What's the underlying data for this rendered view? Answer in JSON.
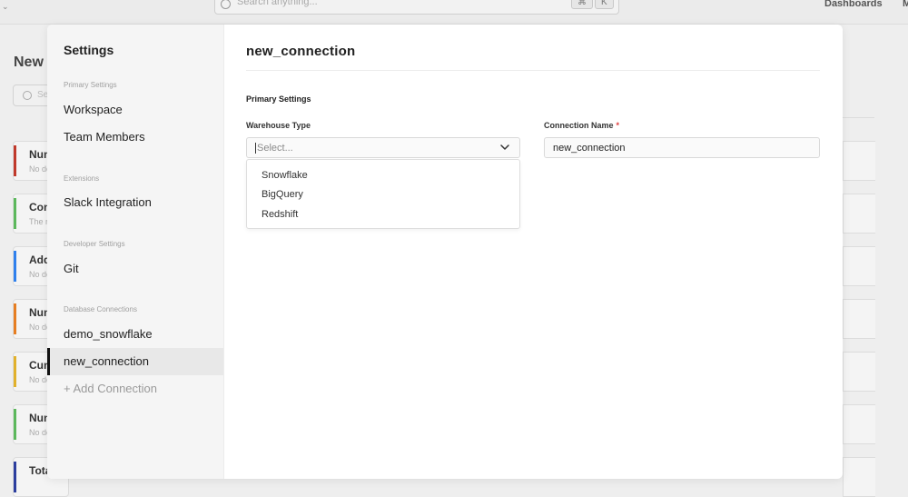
{
  "background": {
    "search_placeholder": "Search anything...",
    "shortcut_keys": [
      "⌘",
      "K"
    ],
    "nav_dashboards": "Dashboards",
    "nav_partial": "M",
    "page_title": "New c",
    "search_partial": "Se",
    "cards": [
      {
        "title": "Num",
        "subtitle": "No de",
        "accent": "#c0392b"
      },
      {
        "title": "Con",
        "subtitle": "The n",
        "accent": "#5cb85c"
      },
      {
        "title": "Add",
        "subtitle": "No de",
        "accent": "#2f80ed"
      },
      {
        "title": "Num",
        "subtitle": "No de",
        "accent": "#e67e22"
      },
      {
        "title": "Cun",
        "subtitle": "No de",
        "accent": "#e1b12c"
      },
      {
        "title": "Nun",
        "subtitle": "No de",
        "accent": "#5cb85c"
      },
      {
        "title": "Tota",
        "subtitle": "",
        "accent": "#2c3e9e"
      }
    ]
  },
  "settings": {
    "title": "Settings",
    "sections": {
      "primary": "Primary Settings",
      "extensions": "Extensions",
      "developer": "Developer Settings",
      "database": "Database Connections"
    },
    "items": {
      "workspace": "Workspace",
      "team_members": "Team Members",
      "slack": "Slack Integration",
      "git": "Git",
      "demo_snowflake": "demo_snowflake",
      "new_connection": "new_connection",
      "add_connection": "+ Add Connection"
    },
    "active_item": "new_connection"
  },
  "main": {
    "title": "new_connection",
    "section_heading": "Primary Settings",
    "warehouse": {
      "label": "Warehouse Type",
      "placeholder": "Select...",
      "options": [
        "Snowflake",
        "BigQuery",
        "Redshift"
      ]
    },
    "connection_name": {
      "label": "Connection Name",
      "required_mark": "*",
      "value": "new_connection"
    }
  }
}
